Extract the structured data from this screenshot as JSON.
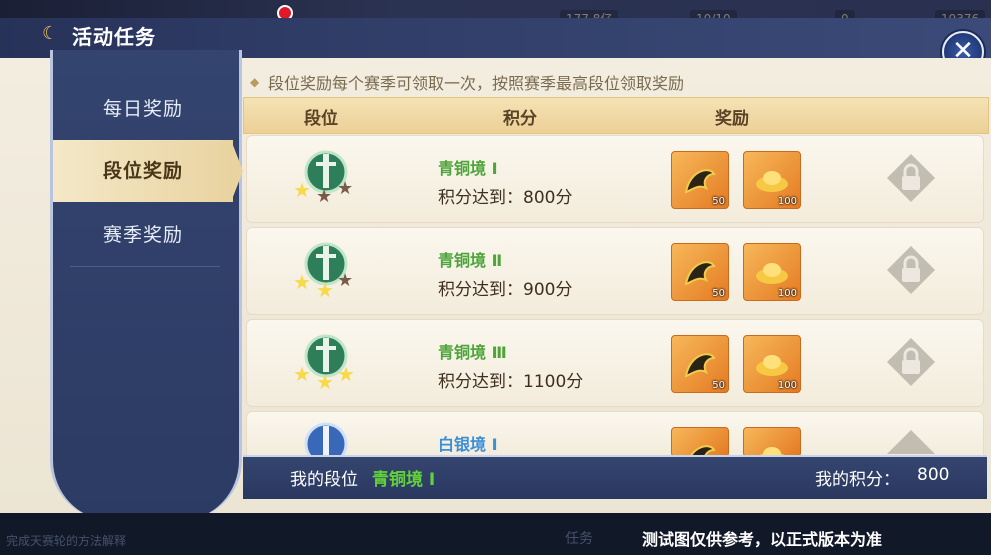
{
  "window": {
    "title": "活动任务"
  },
  "topbar": {
    "res1": "177.8亿",
    "res2": "10/10",
    "res3": "0",
    "res4": "19376"
  },
  "sidebar": {
    "items": [
      {
        "label": "每日奖励",
        "active": false
      },
      {
        "label": "段位奖励",
        "active": true
      },
      {
        "label": "赛季奖励",
        "active": false
      }
    ]
  },
  "notice": "段位奖励每个赛季可领取一次，按照赛季最高段位领取奖励",
  "table": {
    "headers": [
      "段位",
      "积分",
      "奖励"
    ],
    "rows": [
      {
        "rank": "青铜境 Ⅰ",
        "score": "积分达到：800分",
        "stars": 1,
        "rewards": [
          {
            "icon": "dragon-icon",
            "count": "50"
          },
          {
            "icon": "gold-ingot-icon",
            "count": "100"
          }
        ],
        "locked": true
      },
      {
        "rank": "青铜境 Ⅱ",
        "score": "积分达到：900分",
        "stars": 2,
        "rewards": [
          {
            "icon": "dragon-icon",
            "count": "50"
          },
          {
            "icon": "gold-ingot-icon",
            "count": "100"
          }
        ],
        "locked": true
      },
      {
        "rank": "青铜境 Ⅲ",
        "score": "积分达到：1100分",
        "stars": 3,
        "rewards": [
          {
            "icon": "dragon-icon",
            "count": "50"
          },
          {
            "icon": "gold-ingot-icon",
            "count": "100"
          }
        ],
        "locked": true
      },
      {
        "rank": "白银境 Ⅰ",
        "score": "",
        "stars": 1,
        "rewards": [
          {
            "icon": "dragon-icon",
            "count": ""
          },
          {
            "icon": "gold-ingot-icon",
            "count": ""
          }
        ],
        "locked": true
      }
    ]
  },
  "footer": {
    "my_rank_label": "我的段位",
    "my_rank_value": "青铜境 Ⅰ",
    "my_score_label": "我的积分：",
    "my_score_value": "800"
  },
  "disclaimer": "测试图仅供参考，以正式版本为准",
  "background_text": {
    "left": "完成天赛轮的方法解释",
    "mid": "任务"
  },
  "colors": {
    "accent_green": "#4da43a",
    "accent_blue": "#3b8fd6",
    "panel_dark": "#2c3b63",
    "gold": "#ecd097"
  }
}
